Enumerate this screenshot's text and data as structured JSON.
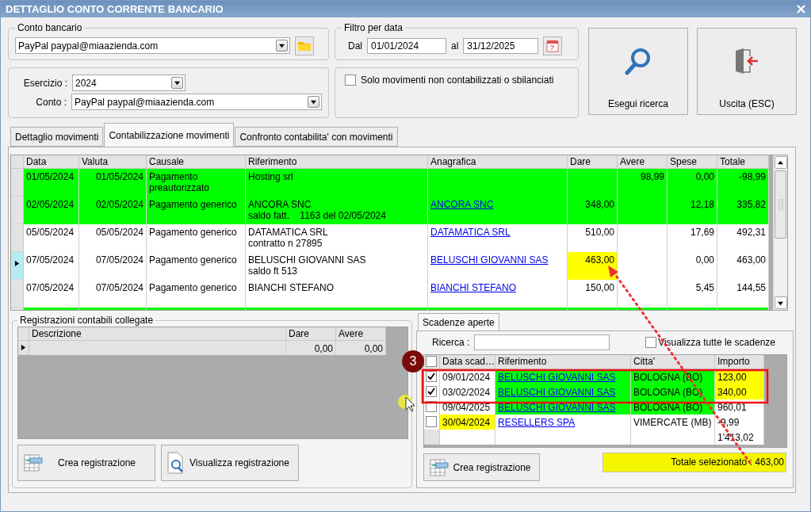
{
  "window": {
    "title": "DETTAGLIO CONTO CORRENTE BANCARIO"
  },
  "conto_bancario": {
    "legend": "Conto bancario",
    "value": "PayPal paypal@miaazienda.com"
  },
  "filtro_per_data": {
    "legend": "Filtro per data",
    "from_label": "Dal",
    "from": "01/01/2024",
    "to_label": "al",
    "to": "31/12/2025"
  },
  "esercizio": {
    "label": "Esercizio :",
    "value": "2024"
  },
  "conto": {
    "label": "Conto :",
    "value": "PayPal paypal@miaazienda.com"
  },
  "solo_movimenti": {
    "label": "Solo movimenti non contabilizzati o sbilanciati",
    "checked": false
  },
  "buttons": [
    {
      "kind": "search",
      "label": "Esegui ricerca"
    },
    {
      "kind": "exit",
      "label": "Uscita (ESC)"
    }
  ],
  "tabs": [
    {
      "label": "Dettaglio movimenti",
      "selected": false
    },
    {
      "label": "Contabilizzazione movimenti",
      "selected": true
    },
    {
      "label": "Confronto contabilita' con movimenti",
      "selected": false
    }
  ],
  "movimenti": {
    "columns": [
      "Data",
      "Valuta",
      "Causale",
      "Riferimento",
      "Anagrafica",
      "Dare",
      "Avere",
      "Spese",
      "Totale"
    ],
    "rows": [
      {
        "data": "01/05/2024",
        "valuta": "01/05/2024",
        "causale": "Pagamento preautorizzato",
        "riferimento": [
          "Hosting srl"
        ],
        "avere": "98,99",
        "spese": "0,00",
        "totale": "-98,99",
        "color": "#00ff00",
        "dare_marked": false,
        "current": false
      },
      {
        "data": "02/05/2024",
        "valuta": "02/05/2024",
        "causale": "Pagamento generico",
        "riferimento": [
          "ANCORA SNC",
          "saldo fatt.    1163 del 02/05/2024"
        ],
        "anagrafica": "ANCORA SNC",
        "dare": "348,00",
        "spese": "12,18",
        "totale": "335,82",
        "color": "#00ff00",
        "dare_marked": false,
        "current": false
      },
      {
        "data": "05/05/2024",
        "valuta": "05/05/2024",
        "causale": "Pagamento generico",
        "riferimento": [
          "DATAMATICA SRL",
          "contratto n 27895"
        ],
        "anagrafica": "DATAMATICA SRL",
        "dare": "510,00",
        "spese": "17,69",
        "totale": "492,31",
        "color": "#ffffff",
        "dare_marked": false,
        "current": false
      },
      {
        "data": "07/05/2024",
        "valuta": "07/05/2024",
        "causale": "Pagamento generico",
        "riferimento": [
          "BELUSCHI GIOVANNI SAS",
          "saldo ft 513"
        ],
        "anagrafica": "BELUSCHI GIOVANNI SAS",
        "dare": "463,00",
        "spese": "0,00",
        "totale": "463,00",
        "color": "#ffffff",
        "dare_marked": true,
        "current": true
      },
      {
        "data": "07/05/2024",
        "valuta": "07/05/2024",
        "causale": "Pagamento generico",
        "riferimento": [
          "BIANCHI STEFANO"
        ],
        "anagrafica": "BIANCHI STEFANO",
        "dare": "150,00",
        "spese": "5,45",
        "totale": "144,55",
        "color": "#ffffff",
        "dare_marked": false,
        "current": false
      }
    ],
    "partial_row": {
      "color": "#00ff00"
    }
  },
  "registrazioni": {
    "legend": "Registrazioni contabili collegate",
    "columns": [
      "Descrizione",
      "Dare",
      "Avere"
    ],
    "rows": [
      {
        "dare": "0,00",
        "avere": "0,00",
        "current": true
      }
    ],
    "buttons": [
      {
        "kind": "create",
        "label": "Crea registrazione"
      },
      {
        "kind": "view",
        "label": "Visualizza registrazione"
      }
    ]
  },
  "scadenze": {
    "tab": {
      "label": "Scadenze aperte",
      "selected": true
    },
    "search_label": "Ricerca :",
    "show_all": {
      "label": "Visualizza tutte le scadenze",
      "checked": false
    },
    "header_checked": false,
    "columns": [
      "Data scad…",
      "Riferimento",
      "Citta'",
      "Importo"
    ],
    "rows": [
      {
        "checked": true,
        "data": "09/01/2024",
        "riferimento": "BELUSCHI GIOVANNI SAS",
        "citta": "BOLOGNA (BO)",
        "importo": "123,00",
        "date_highlight": false,
        "color": "#00ff00",
        "amount_highlight": true
      },
      {
        "checked": true,
        "data": "03/02/2024",
        "riferimento": "BELUSCHI GIOVANNI SAS",
        "citta": "BOLOGNA (BO)",
        "importo": "340,00",
        "date_highlight": false,
        "color": "#00ff00",
        "amount_highlight": true
      },
      {
        "checked": false,
        "data": "09/04/2025",
        "riferimento": "BELUSCHI GIOVANNI SAS",
        "citta": "BOLOGNA (BO)",
        "importo": "960,01",
        "date_highlight": false,
        "color": "#00ff00",
        "amount_highlight": false
      },
      {
        "checked": false,
        "data": "30/04/2024",
        "riferimento": "RESELLERS SPA",
        "citta": "VIMERCATE (MB)",
        "importo": "-9,99",
        "date_highlight": true,
        "color": "#ffffff",
        "amount_highlight": false
      }
    ],
    "total": "1'413,02",
    "button": {
      "kind": "create",
      "label": "Crea registrazione"
    },
    "totale_selezionato": "Totale selezionato : 463,00"
  },
  "annotation": {
    "badge": "3"
  }
}
